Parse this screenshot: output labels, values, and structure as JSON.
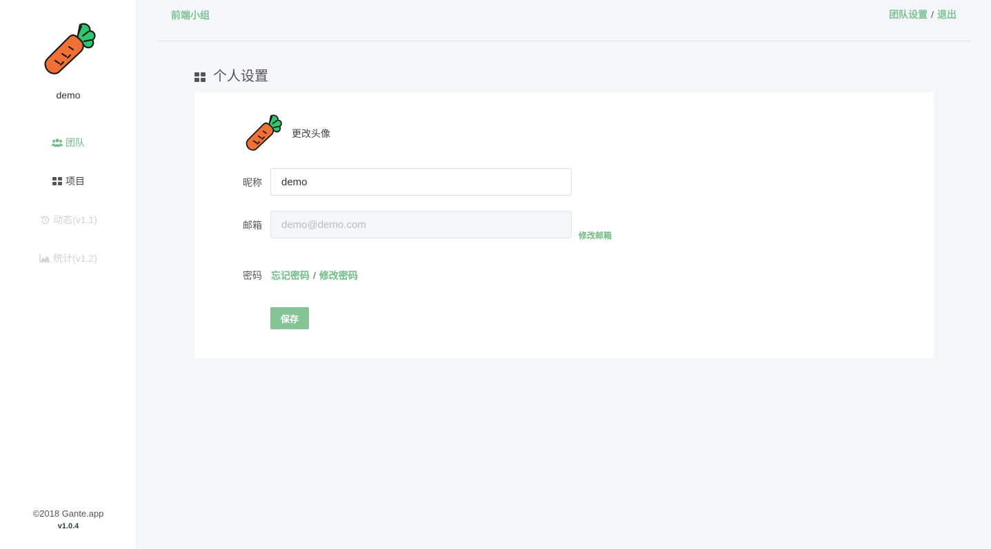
{
  "sidebar": {
    "logo": "carrot-logo",
    "username": "demo",
    "items": [
      {
        "label": "团队",
        "icon": "users-icon",
        "state": "active"
      },
      {
        "label": "项目",
        "icon": "grid-icon",
        "state": "normal"
      },
      {
        "label": "动态(v1.1)",
        "icon": "history-icon",
        "state": "disabled"
      },
      {
        "label": "统计(v1.2)",
        "icon": "area-chart-icon",
        "state": "disabled"
      }
    ],
    "copyright": "©2018 Gante.app",
    "version": "v1.0.4"
  },
  "header": {
    "team_name": "前端小组",
    "team_settings": "团队设置",
    "separator": "/",
    "logout": "退出"
  },
  "page": {
    "title": "个人设置",
    "title_icon": "grid-icon"
  },
  "form": {
    "avatar_icon": "carrot-avatar",
    "change_avatar": "更改头像",
    "nickname_label": "昵称",
    "nickname_value": "demo",
    "email_label": "邮箱",
    "email_placeholder": "demo@demo.com",
    "change_email": "修改邮箱",
    "password_label": "密码",
    "forgot_password": "忘记密码",
    "password_separator": "/",
    "change_password": "修改密码",
    "save_label": "保存"
  },
  "colors": {
    "accent": "#6dbd84",
    "button": "#84c596",
    "background": "#f5f6fa",
    "carrot": "#f07035",
    "leaves": "#2fc66d"
  }
}
